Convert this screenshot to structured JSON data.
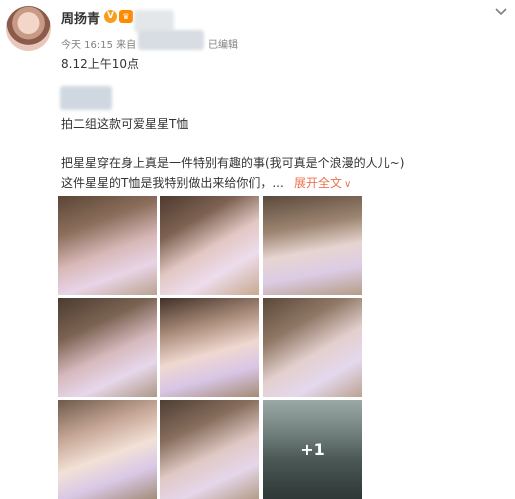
{
  "user": {
    "name": "周扬青",
    "verified_badge": "V",
    "crown_icon": "crown-icon"
  },
  "meta": {
    "time": "今天 16:15 来自",
    "edited": "已编辑"
  },
  "post": {
    "line1": "8.12上午10点",
    "line2": "拍二组这款可爱星星T恤",
    "line3": "把星星穿在身上真是一件特别有趣的事(我可真是个浪漫的人儿~)",
    "line4": "这件星星的T恤是我特别做出来给你们，...",
    "expand_label": "展开全文",
    "expand_icon": "chevron-down-icon"
  },
  "images": {
    "count": 9,
    "more_label": "+1"
  },
  "colors": {
    "link": "#eb7350",
    "meta": "#808080",
    "badge": "#f79e1b"
  }
}
